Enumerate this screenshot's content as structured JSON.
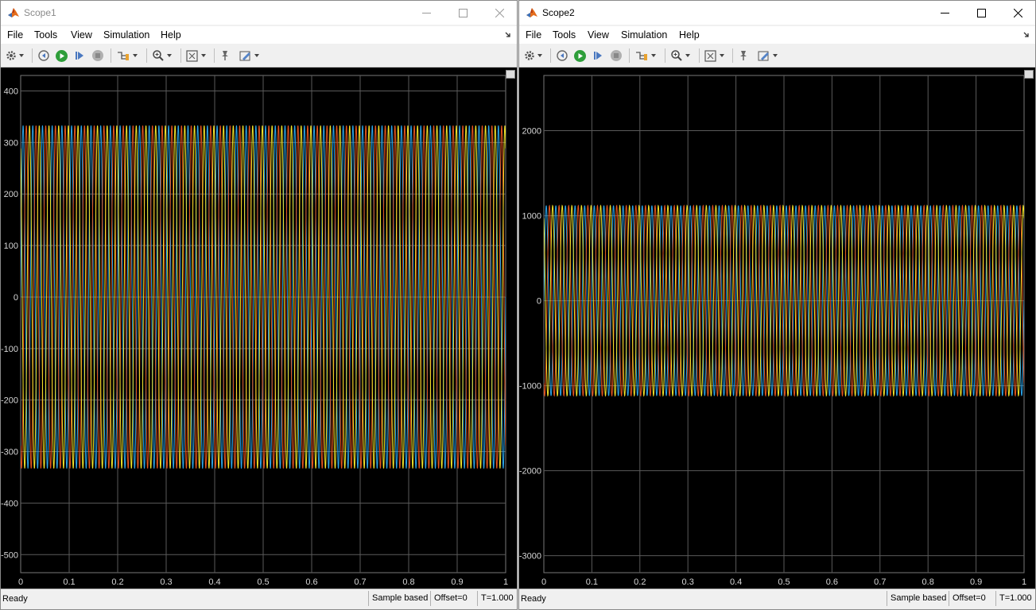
{
  "colors": {
    "plot_background": "#000000",
    "grid": "#5a5a5a",
    "tick_text": "#d6d6d6",
    "series_1": "#2aa6ec",
    "series_2": "#e6541f",
    "series_3": "#f2e52a"
  },
  "windows": [
    {
      "title": "Scope1",
      "menu": [
        "File",
        "Tools",
        "View",
        "Simulation",
        "Help"
      ],
      "status": {
        "ready": "Ready",
        "sample_mode": "Sample based",
        "offset": "Offset=0",
        "time": "T=1.000"
      },
      "toolbar_icons": [
        "gear-icon",
        "stop-back-icon",
        "run-icon",
        "step-forward-icon",
        "stop-icon",
        "signal-icon",
        "zoom-icon",
        "fit-to-view-icon",
        "pin-icon",
        "edit-icon"
      ]
    },
    {
      "title": "Scope2",
      "menu": [
        "File",
        "Tools",
        "View",
        "Simulation",
        "Help"
      ],
      "status": {
        "ready": "Ready",
        "sample_mode": "Sample based",
        "offset": "Offset=0",
        "time": "T=1.000"
      },
      "toolbar_icons": [
        "gear-icon",
        "stop-back-icon",
        "run-icon",
        "step-forward-icon",
        "stop-icon",
        "signal-icon",
        "zoom-icon",
        "fit-to-view-icon",
        "pin-icon",
        "edit-icon"
      ]
    }
  ],
  "chart_data": [
    {
      "type": "line",
      "x_ticks": [
        "0",
        "0.1",
        "0.2",
        "0.3",
        "0.4",
        "0.5",
        "0.6",
        "0.7",
        "0.8",
        "0.9",
        "1"
      ],
      "y_ticks": [
        "400",
        "300",
        "200",
        "100",
        "0",
        "-100",
        "-200",
        "-300",
        "-400",
        "-500"
      ],
      "y_tick_values": [
        400,
        300,
        200,
        100,
        0,
        -100,
        -200,
        -300,
        -400,
        -500
      ],
      "xlim": [
        0,
        1
      ],
      "ylim": [
        -535,
        430
      ],
      "grid": true,
      "series_style": "three-phase sinusoids",
      "amplitude": 333,
      "frequency_hz": 50,
      "phase_shift_deg": 120,
      "cycles_per_view": 50
    },
    {
      "type": "line",
      "x_ticks": [
        "0",
        "0.1",
        "0.2",
        "0.3",
        "0.4",
        "0.5",
        "0.6",
        "0.7",
        "0.8",
        "0.9",
        "1"
      ],
      "y_ticks": [
        "2000",
        "1000",
        "0",
        "-1000",
        "-2000",
        "-3000"
      ],
      "y_tick_values": [
        2000,
        1000,
        0,
        -1000,
        -2000,
        -3000
      ],
      "xlim": [
        0,
        1
      ],
      "ylim": [
        -3200,
        2650
      ],
      "grid": true,
      "series_style": "three-phase sinusoids",
      "amplitude": 1120,
      "frequency_hz": 50,
      "phase_shift_deg": 120,
      "cycles_per_view": 50
    }
  ]
}
